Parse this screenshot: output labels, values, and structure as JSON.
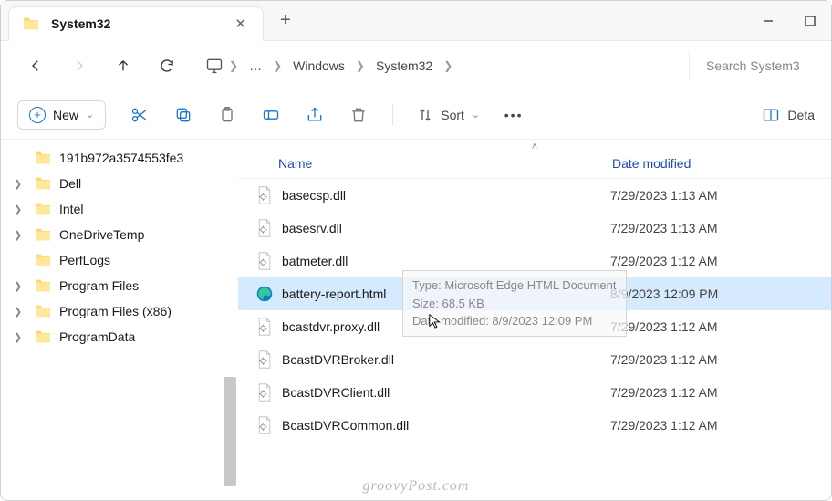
{
  "titlebar": {
    "tab_title": "System32"
  },
  "breadcrumbs": {
    "ellipsis": "…",
    "seg1": "Windows",
    "seg2": "System32"
  },
  "search": {
    "placeholder": "Search System3"
  },
  "toolbar": {
    "new_label": "New",
    "sort_label": "Sort",
    "detail_label": "Deta"
  },
  "columns": {
    "name": "Name",
    "date": "Date modified"
  },
  "sidebar": {
    "items": [
      {
        "label": "191b972a3574553fe3",
        "expandable": false
      },
      {
        "label": "Dell",
        "expandable": true
      },
      {
        "label": "Intel",
        "expandable": true
      },
      {
        "label": "OneDriveTemp",
        "expandable": true
      },
      {
        "label": "PerfLogs",
        "expandable": false
      },
      {
        "label": "Program Files",
        "expandable": true
      },
      {
        "label": "Program Files (x86)",
        "expandable": true
      },
      {
        "label": "ProgramData",
        "expandable": true
      }
    ]
  },
  "files": [
    {
      "name": "basecsp.dll",
      "date": "7/29/2023 1:13 AM",
      "type": "dll",
      "selected": false
    },
    {
      "name": "basesrv.dll",
      "date": "7/29/2023 1:13 AM",
      "type": "dll",
      "selected": false
    },
    {
      "name": "batmeter.dll",
      "date": "7/29/2023 1:12 AM",
      "type": "dll",
      "selected": false
    },
    {
      "name": "battery-report.html",
      "date": "8/9/2023 12:09 PM",
      "type": "html",
      "selected": true
    },
    {
      "name": "bcastdvr.proxy.dll",
      "date": "7/29/2023 1:12 AM",
      "type": "dll",
      "selected": false
    },
    {
      "name": "BcastDVRBroker.dll",
      "date": "7/29/2023 1:12 AM",
      "type": "dll",
      "selected": false
    },
    {
      "name": "BcastDVRClient.dll",
      "date": "7/29/2023 1:12 AM",
      "type": "dll",
      "selected": false
    },
    {
      "name": "BcastDVRCommon.dll",
      "date": "7/29/2023 1:12 AM",
      "type": "dll",
      "selected": false
    }
  ],
  "tooltip": {
    "line1": "Type: Microsoft Edge HTML Document",
    "line2": "Size: 68.5 KB",
    "line3": "Date modified: 8/9/2023 12:09 PM"
  },
  "watermark": "groovyPost.com"
}
